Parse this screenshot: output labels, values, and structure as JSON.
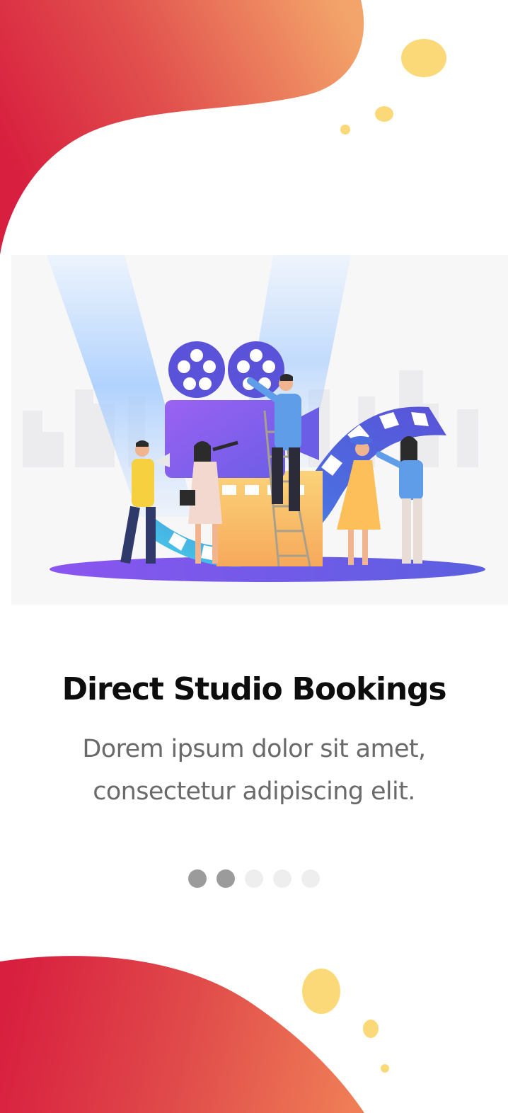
{
  "onboarding": {
    "title": "Direct Studio Bookings",
    "description_line1": "Dorem ipsum dolor sit amet,",
    "description_line2": "consectetur adipiscing elit."
  },
  "pagination": {
    "total": 5,
    "active_indices": [
      0,
      1
    ],
    "active_color": "#9b9b9b",
    "inactive_color": "#eeeeee"
  },
  "illustration": {
    "subject": "film-production-crew-illustration"
  },
  "colors": {
    "gradient_red": "#d81f3f",
    "gradient_orange": "#f0a068",
    "accent_yellow": "#fcd978",
    "purple": "#7b5be6",
    "blue": "#4b6fe0",
    "cyan": "#45d3e6"
  }
}
